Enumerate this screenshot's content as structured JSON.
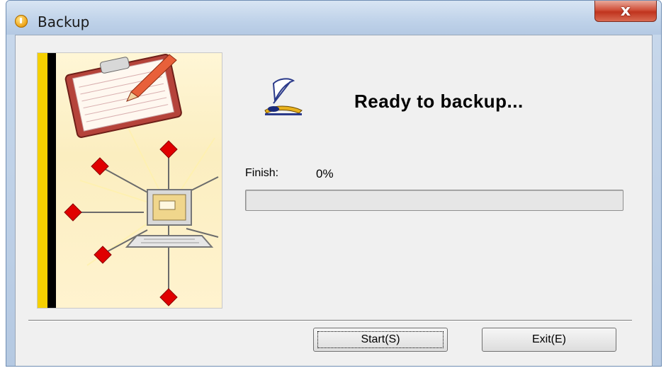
{
  "window": {
    "title": "Backup",
    "close_label": "x"
  },
  "main": {
    "heading": "Ready to backup...",
    "finish_label": "Finish:",
    "finish_value": "0%",
    "progress_fraction": 0
  },
  "buttons": {
    "start_label": "Start(S)",
    "exit_label": "Exit(E)"
  },
  "icons": {
    "title": "backup-app-icon",
    "close": "close-icon",
    "status": "quill-pen-icon",
    "banner": "backup-network-illustration"
  },
  "colors": {
    "accent_yellow": "#f5d000",
    "diamond_red": "#e00000",
    "client_bg": "#f0f0f0"
  }
}
